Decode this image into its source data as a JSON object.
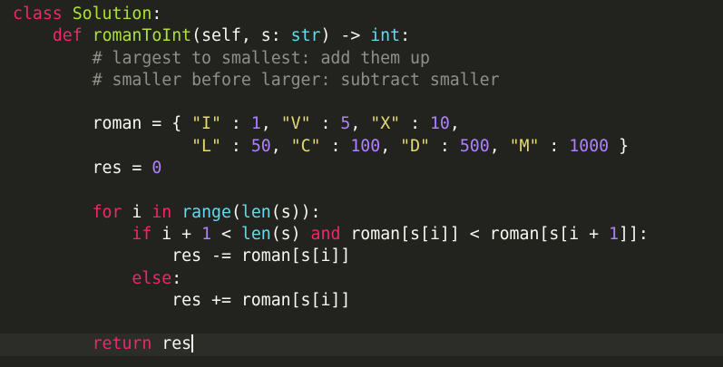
{
  "colors": {
    "background": "#22231e",
    "keyword": "#f0266f",
    "function": "#aee239",
    "builtin": "#66d9ef",
    "number": "#ae81ff",
    "string": "#e6db74",
    "comment": "#8f908a",
    "text": "#f8f8f2"
  },
  "code": {
    "lines": [
      [
        [
          "kw",
          "class"
        ],
        [
          "pl",
          " "
        ],
        [
          "fn",
          "Solution"
        ],
        [
          "pl",
          ":"
        ]
      ],
      [
        [
          "pl",
          "    "
        ],
        [
          "kw",
          "def"
        ],
        [
          "pl",
          " "
        ],
        [
          "fn",
          "romanToInt"
        ],
        [
          "pl",
          "(self, s: "
        ],
        [
          "bi",
          "str"
        ],
        [
          "pl",
          ") -> "
        ],
        [
          "bi",
          "int"
        ],
        [
          "pl",
          ":"
        ]
      ],
      [
        [
          "pl",
          "        "
        ],
        [
          "cm",
          "# largest to smallest: add them up"
        ]
      ],
      [
        [
          "pl",
          "        "
        ],
        [
          "cm",
          "# smaller before larger: subtract smaller"
        ]
      ],
      [],
      [
        [
          "pl",
          "        roman = { "
        ],
        [
          "str",
          "\"I\""
        ],
        [
          "pl",
          " : "
        ],
        [
          "num",
          "1"
        ],
        [
          "pl",
          ", "
        ],
        [
          "str",
          "\"V\""
        ],
        [
          "pl",
          " : "
        ],
        [
          "num",
          "5"
        ],
        [
          "pl",
          ", "
        ],
        [
          "str",
          "\"X\""
        ],
        [
          "pl",
          " : "
        ],
        [
          "num",
          "10"
        ],
        [
          "pl",
          ","
        ]
      ],
      [
        [
          "pl",
          "                  "
        ],
        [
          "str",
          "\"L\""
        ],
        [
          "pl",
          " : "
        ],
        [
          "num",
          "50"
        ],
        [
          "pl",
          ", "
        ],
        [
          "str",
          "\"C\""
        ],
        [
          "pl",
          " : "
        ],
        [
          "num",
          "100"
        ],
        [
          "pl",
          ", "
        ],
        [
          "str",
          "\"D\""
        ],
        [
          "pl",
          " : "
        ],
        [
          "num",
          "500"
        ],
        [
          "pl",
          ", "
        ],
        [
          "str",
          "\"M\""
        ],
        [
          "pl",
          " : "
        ],
        [
          "num",
          "1000"
        ],
        [
          "pl",
          " }"
        ]
      ],
      [
        [
          "pl",
          "        res = "
        ],
        [
          "num",
          "0"
        ]
      ],
      [],
      [
        [
          "pl",
          "        "
        ],
        [
          "kw",
          "for"
        ],
        [
          "pl",
          " i "
        ],
        [
          "kw",
          "in"
        ],
        [
          "pl",
          " "
        ],
        [
          "bi",
          "range"
        ],
        [
          "pl",
          "("
        ],
        [
          "bi",
          "len"
        ],
        [
          "pl",
          "(s)):"
        ]
      ],
      [
        [
          "pl",
          "            "
        ],
        [
          "kw",
          "if"
        ],
        [
          "pl",
          " i + "
        ],
        [
          "num",
          "1"
        ],
        [
          "pl",
          " < "
        ],
        [
          "bi",
          "len"
        ],
        [
          "pl",
          "(s) "
        ],
        [
          "kw",
          "and"
        ],
        [
          "pl",
          " roman[s[i]] < roman[s[i + "
        ],
        [
          "num",
          "1"
        ],
        [
          "pl",
          "]]:"
        ]
      ],
      [
        [
          "pl",
          "                res -= roman[s[i]]"
        ]
      ],
      [
        [
          "pl",
          "            "
        ],
        [
          "kw",
          "else"
        ],
        [
          "pl",
          ":"
        ]
      ],
      [
        [
          "pl",
          "                res += roman[s[i]]"
        ]
      ],
      [],
      [
        [
          "pl",
          "        "
        ],
        [
          "kw",
          "return"
        ],
        [
          "pl",
          " res"
        ]
      ]
    ],
    "current_line": 15
  }
}
